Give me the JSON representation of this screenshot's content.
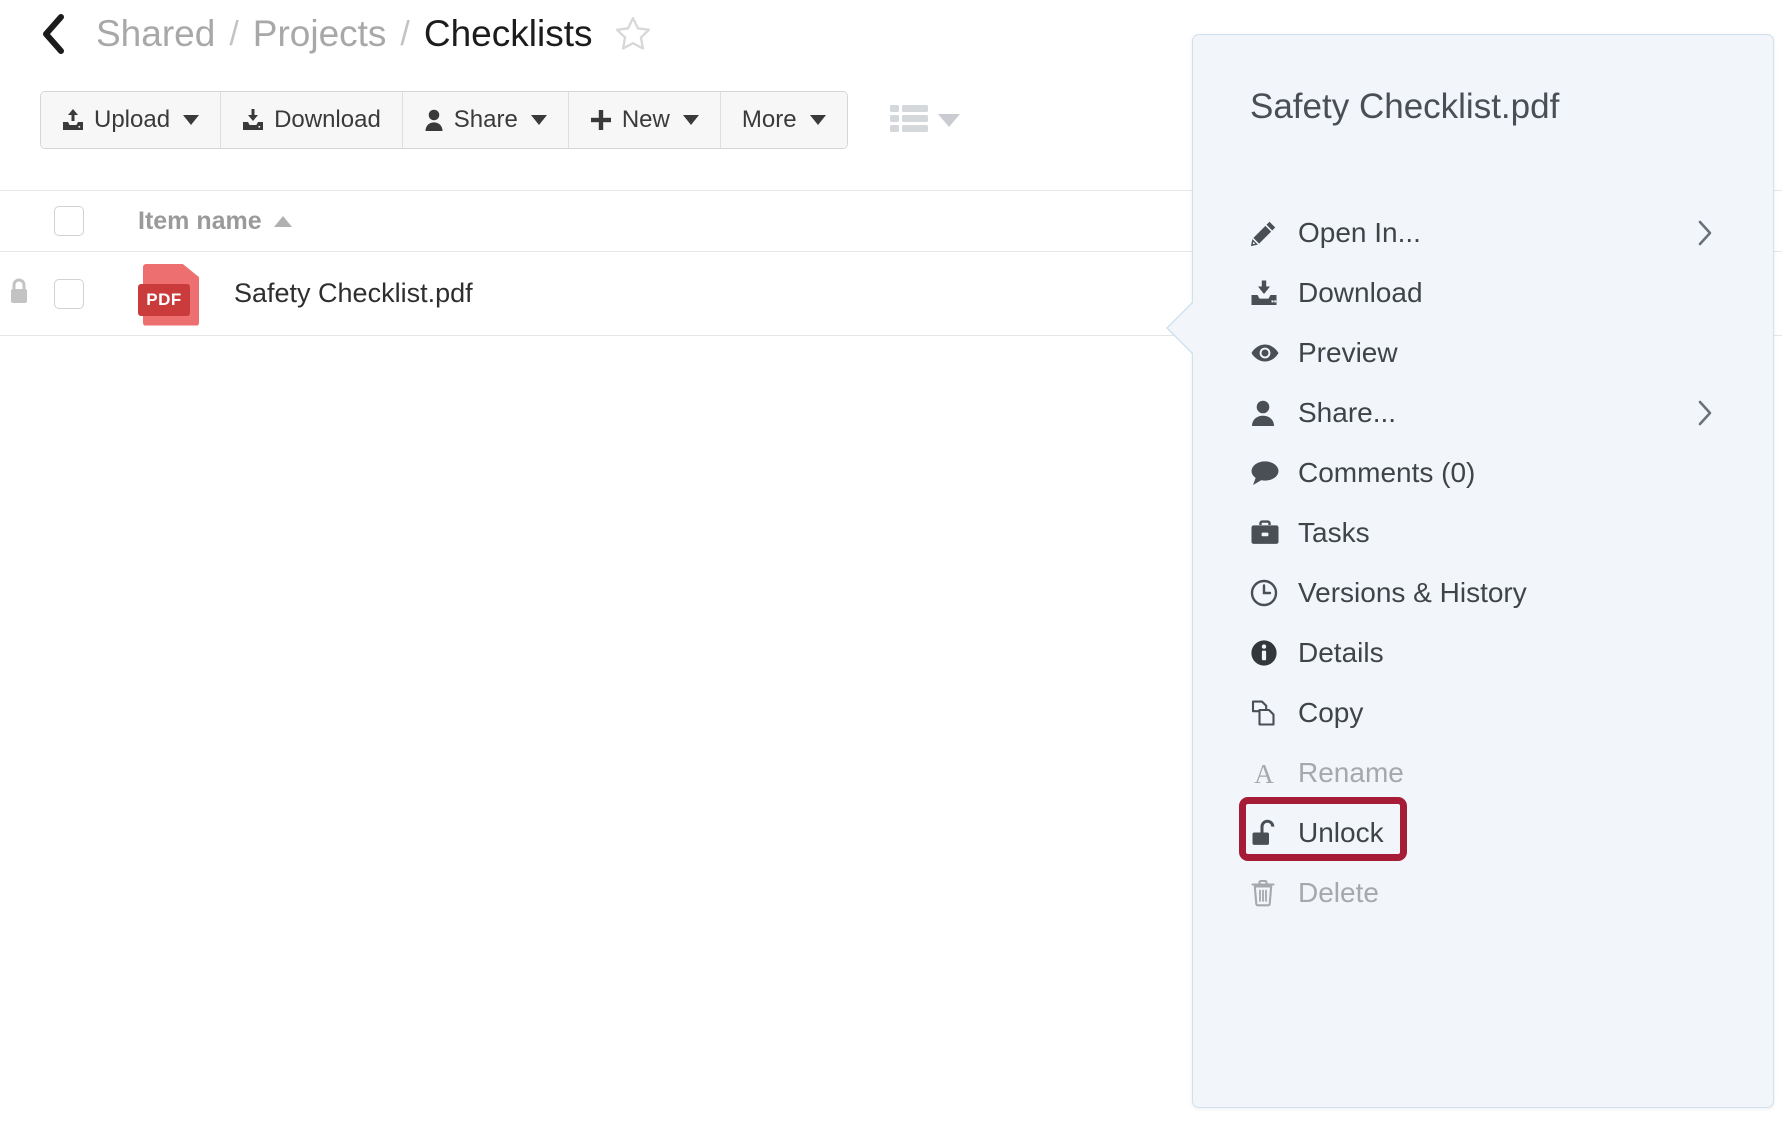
{
  "breadcrumb": {
    "back_icon": "chevron-left-icon",
    "items": [
      {
        "label": "Shared",
        "current": false
      },
      {
        "label": "Projects",
        "current": false
      },
      {
        "label": "Checklists",
        "current": true
      }
    ],
    "separator": "/",
    "favorite_icon": "star-outline-icon"
  },
  "toolbar": {
    "buttons": [
      {
        "label": "Upload",
        "icon": "upload-icon",
        "caret": true
      },
      {
        "label": "Download",
        "icon": "download-icon",
        "caret": false
      },
      {
        "label": "Share",
        "icon": "person-icon",
        "caret": true
      },
      {
        "label": "New",
        "icon": "plus-icon",
        "caret": true
      },
      {
        "label": "More",
        "icon": "",
        "caret": true
      }
    ],
    "view_toggle_icon": "list-view-icon"
  },
  "table": {
    "header": {
      "select_all_checkbox": "",
      "name_column": "Item name",
      "sort_direction_icon": "sort-ascending-icon"
    },
    "rows": [
      {
        "locked": true,
        "lock_icon": "lock-closed-icon",
        "selected": false,
        "file_icon": "pdf-file-icon",
        "file_type_label": "PDF",
        "name": "Safety Checklist.pdf"
      }
    ]
  },
  "context_menu": {
    "title": "Safety Checklist.pdf",
    "items": [
      {
        "label": "Open In...",
        "icon": "pencil-icon",
        "disabled": false,
        "submenu": true,
        "highlighted": false
      },
      {
        "label": "Download",
        "icon": "download-icon",
        "disabled": false,
        "submenu": false,
        "highlighted": false
      },
      {
        "label": "Preview",
        "icon": "eye-icon",
        "disabled": false,
        "submenu": false,
        "highlighted": false
      },
      {
        "label": "Share...",
        "icon": "person-icon",
        "disabled": false,
        "submenu": true,
        "highlighted": false
      },
      {
        "label": "Comments (0)",
        "icon": "comment-icon",
        "disabled": false,
        "submenu": false,
        "highlighted": false
      },
      {
        "label": "Tasks",
        "icon": "briefcase-icon",
        "disabled": false,
        "submenu": false,
        "highlighted": false
      },
      {
        "label": "Versions & History",
        "icon": "clock-icon",
        "disabled": false,
        "submenu": false,
        "highlighted": false
      },
      {
        "label": "Details",
        "icon": "info-icon",
        "disabled": false,
        "submenu": false,
        "highlighted": false
      },
      {
        "label": "Copy",
        "icon": "copy-icon",
        "disabled": false,
        "submenu": false,
        "highlighted": false
      },
      {
        "label": "Rename",
        "icon": "letter-a-icon",
        "disabled": true,
        "submenu": false,
        "highlighted": false
      },
      {
        "label": "Unlock",
        "icon": "unlock-icon",
        "disabled": false,
        "submenu": false,
        "highlighted": true
      },
      {
        "label": "Delete",
        "icon": "trash-icon",
        "disabled": true,
        "submenu": false,
        "highlighted": false
      }
    ]
  },
  "colors": {
    "panel_background": "#f2f6fa",
    "panel_border": "#cfe0ee",
    "highlight_outline": "#a61c37",
    "pdf_icon_page": "#ee6f6f",
    "pdf_icon_band": "#ca3b3b",
    "breadcrumb_inactive": "#a8a8a8",
    "breadcrumb_active": "#1c1c1c"
  }
}
